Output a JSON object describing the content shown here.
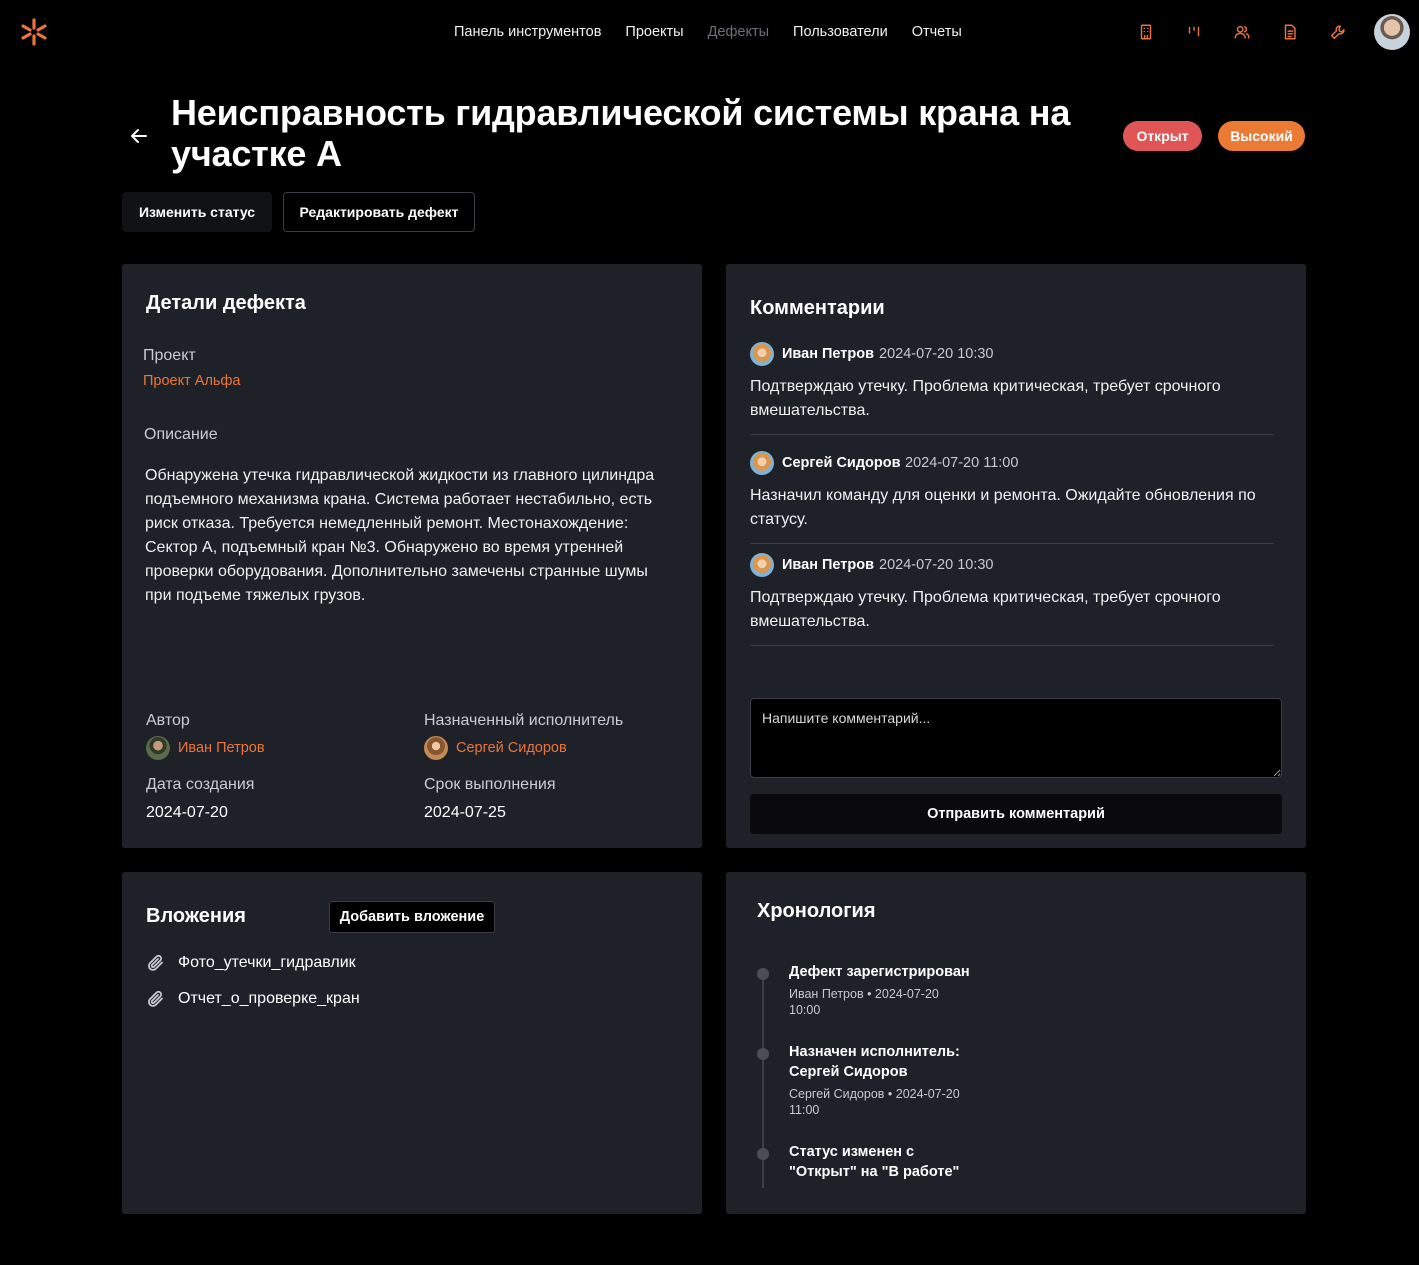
{
  "header": {
    "nav": [
      {
        "label": "Панель инструментов",
        "active": false
      },
      {
        "label": "Проекты",
        "active": false
      },
      {
        "label": "Дефекты",
        "active": true
      },
      {
        "label": "Пользователи",
        "active": false
      },
      {
        "label": "Отчеты",
        "active": false
      }
    ],
    "icons": [
      "building-icon",
      "kanban-icon",
      "users-icon",
      "document-icon",
      "wrench-icon"
    ],
    "accent_color": "#e9753a"
  },
  "defect": {
    "title": "Неисправность гидравлической системы крана на участке А",
    "status_badge": "Открыт",
    "priority_badge": "Высокий",
    "status_color": "#e05656",
    "priority_color": "#ea7a34"
  },
  "actions": {
    "change_status": "Изменить статус",
    "edit_defect": "Редактировать дефект"
  },
  "details": {
    "heading": "Детали дефекта",
    "project_label": "Проект",
    "project_value": "Проект Альфа",
    "description_label": "Описание",
    "description": "Обнаружена утечка гидравлической жидкости из главного цилиндра подъемного механизма крана. Система работает нестабильно, есть риск отказа. Требуется немедленный ремонт. Местонахождение: Сектор А, подъемный кран №3. Обнаружено во время утренней проверки оборудования. Дополнительно замечены странные шумы при подъеме тяжелых грузов.",
    "author_label": "Автор",
    "author_value": "Иван Петров",
    "assignee_label": "Назначенный исполнитель",
    "assignee_value": "Сергей Сидоров",
    "created_label": "Дата создания",
    "created_value": "2024-07-20",
    "due_label": "Срок выполнения",
    "due_value": "2024-07-25"
  },
  "comments": {
    "heading": "Комментарии",
    "items": [
      {
        "author": "Иван Петров",
        "date": "2024-07-20 10:30",
        "text": "Подтверждаю утечку. Проблема критическая, требует срочного вмешательства."
      },
      {
        "author": "Сергей Сидоров",
        "date": "2024-07-20 11:00",
        "text": "Назначил команду для оценки и ремонта. Ожидайте обновления по статусу."
      },
      {
        "author": "Иван Петров",
        "date": "2024-07-20 10:30",
        "text": "Подтверждаю утечку. Проблема критическая, требует срочного вмешательства."
      }
    ],
    "input_placeholder": "Напишите комментарий...",
    "send_label": "Отправить комментарий"
  },
  "attachments": {
    "heading": "Вложения",
    "add_label": "Добавить вложение",
    "files": [
      "Фото_утечки_гидравлик",
      "Отчет_о_проверке_кран"
    ]
  },
  "timeline": {
    "heading": "Хронология",
    "events": [
      {
        "title": "Дефект зарегистрирован",
        "meta": "Иван Петров • 2024-07-20 10:00"
      },
      {
        "title": "Назначен исполнитель: Сергей Сидоров",
        "meta": "Сергей Сидоров • 2024-07-20 11:00"
      },
      {
        "title": "Статус изменен с \"Открыт\" на \"В работе\"",
        "meta": ""
      }
    ]
  }
}
